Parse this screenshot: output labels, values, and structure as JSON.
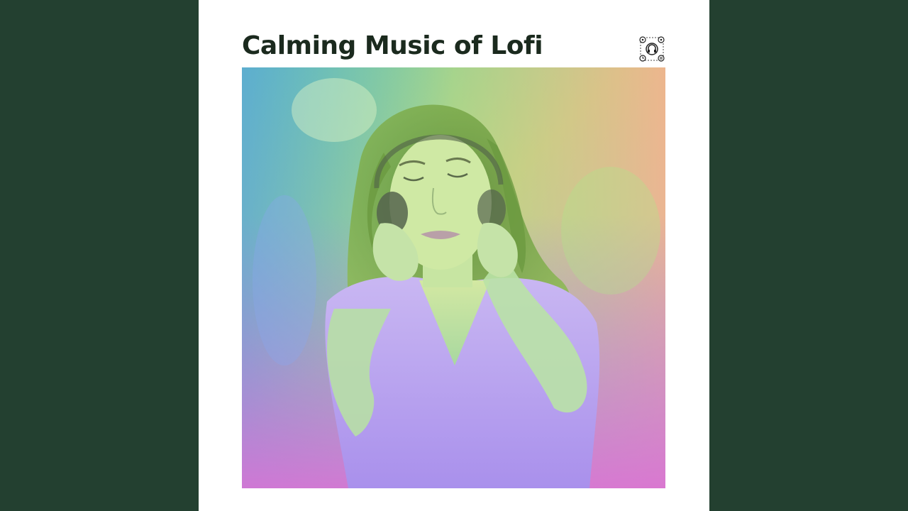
{
  "album": {
    "title": "Calming Music of Lofi"
  },
  "logo": {
    "icon": "headphones-badge-icon"
  },
  "photo": {
    "subject": "woman-with-headphones",
    "gradient": {
      "top_left": "#4fd1a8",
      "top_right": "#f8b08a",
      "middle": "#b7e27a",
      "bottom_left": "#e56fd0",
      "bottom_right": "#7fd8e8"
    }
  },
  "colors": {
    "background": "#234030",
    "cover": "#ffffff",
    "title_text": "#1b2a1e"
  }
}
